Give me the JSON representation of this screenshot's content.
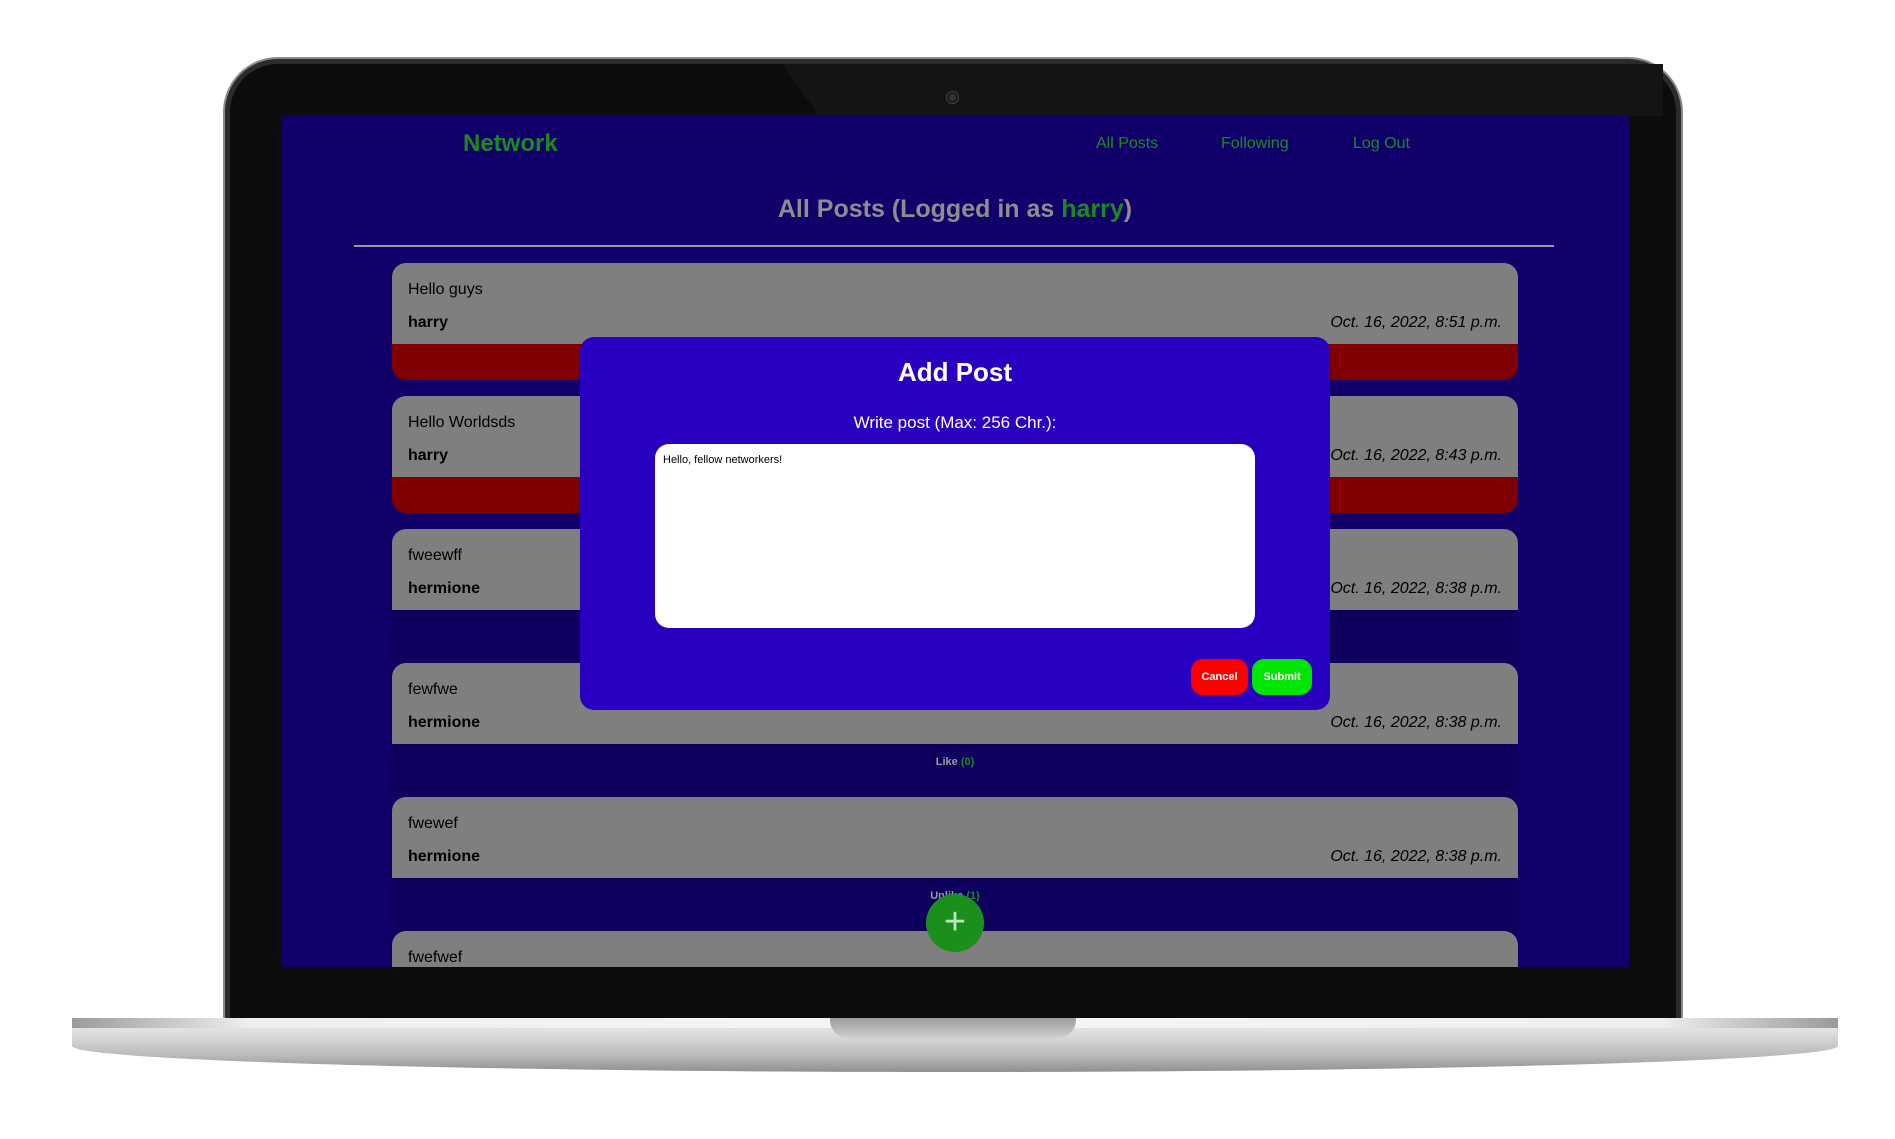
{
  "nav": {
    "brand": "Network",
    "links": [
      "All Posts",
      "Following",
      "Log Out"
    ]
  },
  "page": {
    "title_prefix": "All Posts (Logged in as ",
    "user": "harry",
    "title_suffix": ")"
  },
  "posts": [
    {
      "text": "Hello guys",
      "author": "harry",
      "time": "Oct. 16, 2022, 8:51 p.m.",
      "action": "delete"
    },
    {
      "text": "Hello Worldsds",
      "author": "harry",
      "time": "Oct. 16, 2022, 8:43 p.m.",
      "action": "delete"
    },
    {
      "text": "fweewff",
      "author": "hermione",
      "time": "Oct. 16, 2022, 8:38 p.m.",
      "action": "like"
    },
    {
      "text": "fewfwe",
      "author": "hermione",
      "time": "Oct. 16, 2022, 8:38 p.m.",
      "action": "like",
      "like_label": "Like",
      "like_count": "(0)"
    },
    {
      "text": "fwewef",
      "author": "hermione",
      "time": "Oct. 16, 2022, 8:38 p.m.",
      "action": "like",
      "like_label": "Unlike",
      "like_count": "(1)"
    },
    {
      "text": "fwefwef",
      "author": "",
      "time": "",
      "action": ""
    }
  ],
  "modal": {
    "title": "Add Post",
    "label": "Write post (Max: 256 Chr.):",
    "textarea_value": "Hello, fellow networkers!",
    "cancel_label": "Cancel",
    "submit_label": "Submit"
  },
  "fab": {
    "icon": "plus-icon",
    "glyph": "+"
  },
  "colors": {
    "background": "#12006a",
    "accent": "#1b8a1e",
    "modal": "#2a00c0",
    "card": "#7f7f7f",
    "delete": "#800000",
    "cancel": "#ff0000",
    "submit": "#00e600"
  }
}
